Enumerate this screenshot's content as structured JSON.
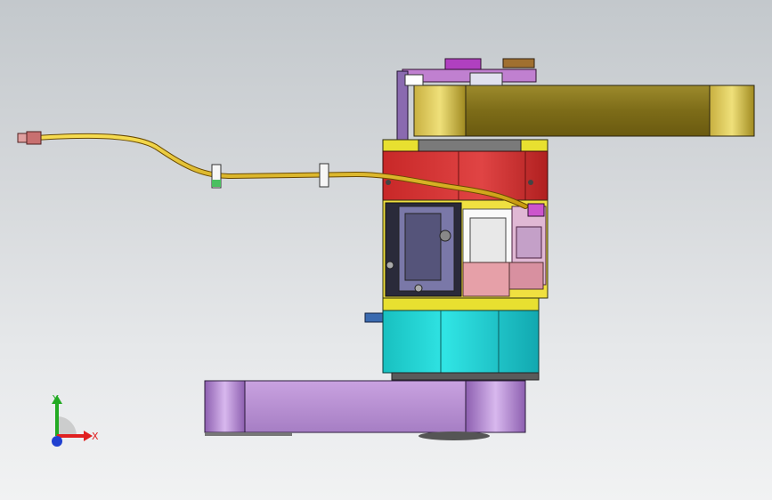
{
  "view": {
    "background_top": "#c3c8cc",
    "background_bottom": "#f1f2f3"
  },
  "triad": {
    "x_label": "X",
    "y_label": "Y",
    "x_color": "#e02020",
    "y_color": "#22aa22",
    "z_color": "#2040d0"
  },
  "parts": {
    "upper_arm": "#7a6a1a",
    "lower_arm": "#b48ad0",
    "motor_housing": "#d63030",
    "base_ring": "#22d0d0",
    "cable": "#e8c020",
    "cover_plate": "#3a3a55",
    "gear_block": "#e6a0a8",
    "yellow_frame": "#e8e030"
  }
}
